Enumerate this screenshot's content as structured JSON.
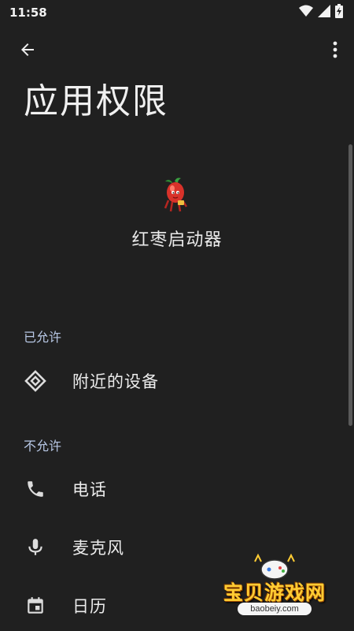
{
  "status_bar": {
    "time": "11:58",
    "icons": [
      "wifi-icon",
      "signal-icon",
      "battery-charging-icon"
    ]
  },
  "app_bar": {
    "back_icon": "arrow-back-icon",
    "more_icon": "more-vert-icon"
  },
  "page": {
    "title": "应用权限"
  },
  "app": {
    "name": "红枣启动器",
    "icon": "red-date-mascot-icon"
  },
  "sections": {
    "allowed": {
      "header": "已允许",
      "items": [
        {
          "label": "附近的设备",
          "icon": "nearby-devices-icon"
        }
      ]
    },
    "denied": {
      "header": "不允许",
      "items": [
        {
          "label": "电话",
          "icon": "phone-icon"
        },
        {
          "label": "麦克风",
          "icon": "microphone-icon"
        },
        {
          "label": "日历",
          "icon": "calendar-icon"
        }
      ]
    }
  },
  "watermark": {
    "text": "宝贝游戏网",
    "url": "baobeiy.com"
  },
  "colors": {
    "background": "#202020",
    "section_header": "#b8c8e6",
    "text": "#ececec",
    "watermark": "#ffcc33"
  }
}
